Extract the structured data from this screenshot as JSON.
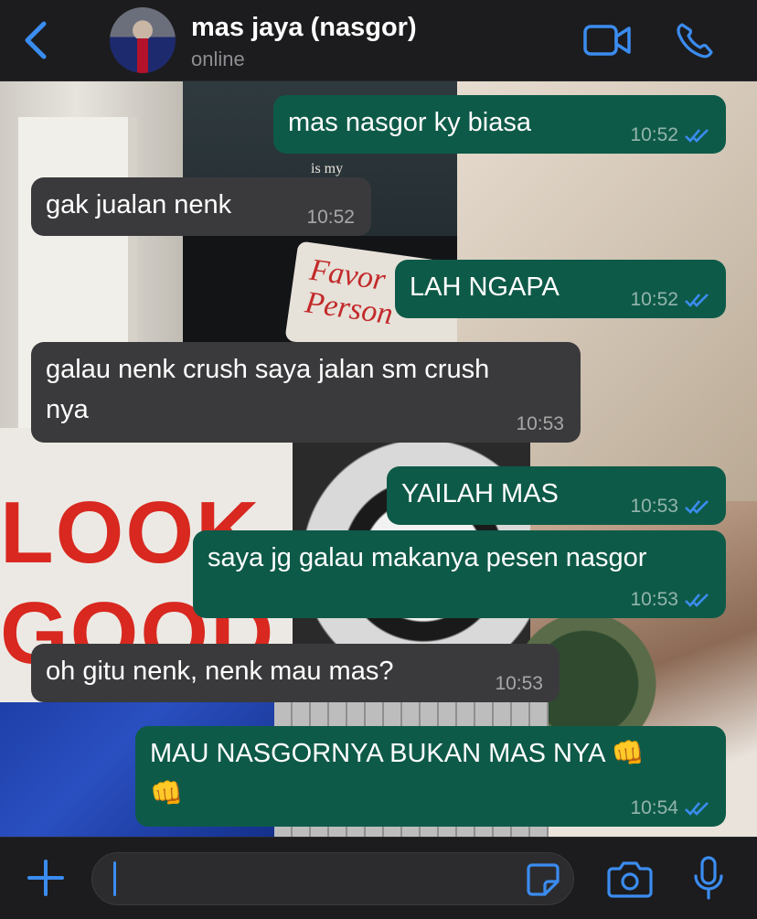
{
  "header": {
    "back_icon": "chevron-left-icon",
    "contact_name": "mas jaya (nasgor)",
    "status": "online",
    "video_icon": "video-camera-icon",
    "call_icon": "phone-icon",
    "accent": "#3b8cf0"
  },
  "messages": [
    {
      "direction": "out",
      "text": "mas nasgor ky biasa",
      "time": "10:52",
      "read": true
    },
    {
      "direction": "in",
      "text": "gak jualan nenk",
      "time": "10:52"
    },
    {
      "direction": "out",
      "text": "LAH NGAPA",
      "time": "10:52",
      "read": true
    },
    {
      "direction": "in",
      "text": "galau nenk crush saya jalan sm crush\nnya",
      "time": "10:53"
    },
    {
      "direction": "out",
      "text": "YAILAH MAS",
      "time": "10:53",
      "read": true
    },
    {
      "direction": "out",
      "text": "saya jg galau makanya pesen nasgor",
      "time": "10:53",
      "read": true
    },
    {
      "direction": "in",
      "text": "oh gitu nenk, nenk mau mas?",
      "time": "10:53"
    },
    {
      "direction": "out",
      "text": "MAU NASGORNYA BUKAN MAS NYA 👊\n👊",
      "time": "10:54",
      "read": true
    }
  ],
  "wallpaper_text": {
    "shirt": "is my",
    "tag": "Favor\nPerson",
    "poster": "LOOK\nGOOD"
  },
  "input": {
    "placeholder": "",
    "value": "",
    "plus_icon": "plus-icon",
    "sticker_icon": "sticker-icon",
    "camera_icon": "camera-icon",
    "mic_icon": "microphone-icon"
  },
  "colors": {
    "outgoing_bubble": "#0e5a48",
    "incoming_bubble": "#3a3a3c",
    "read_ticks": "#3b8cf0",
    "bar_background": "#1c1c1e"
  }
}
